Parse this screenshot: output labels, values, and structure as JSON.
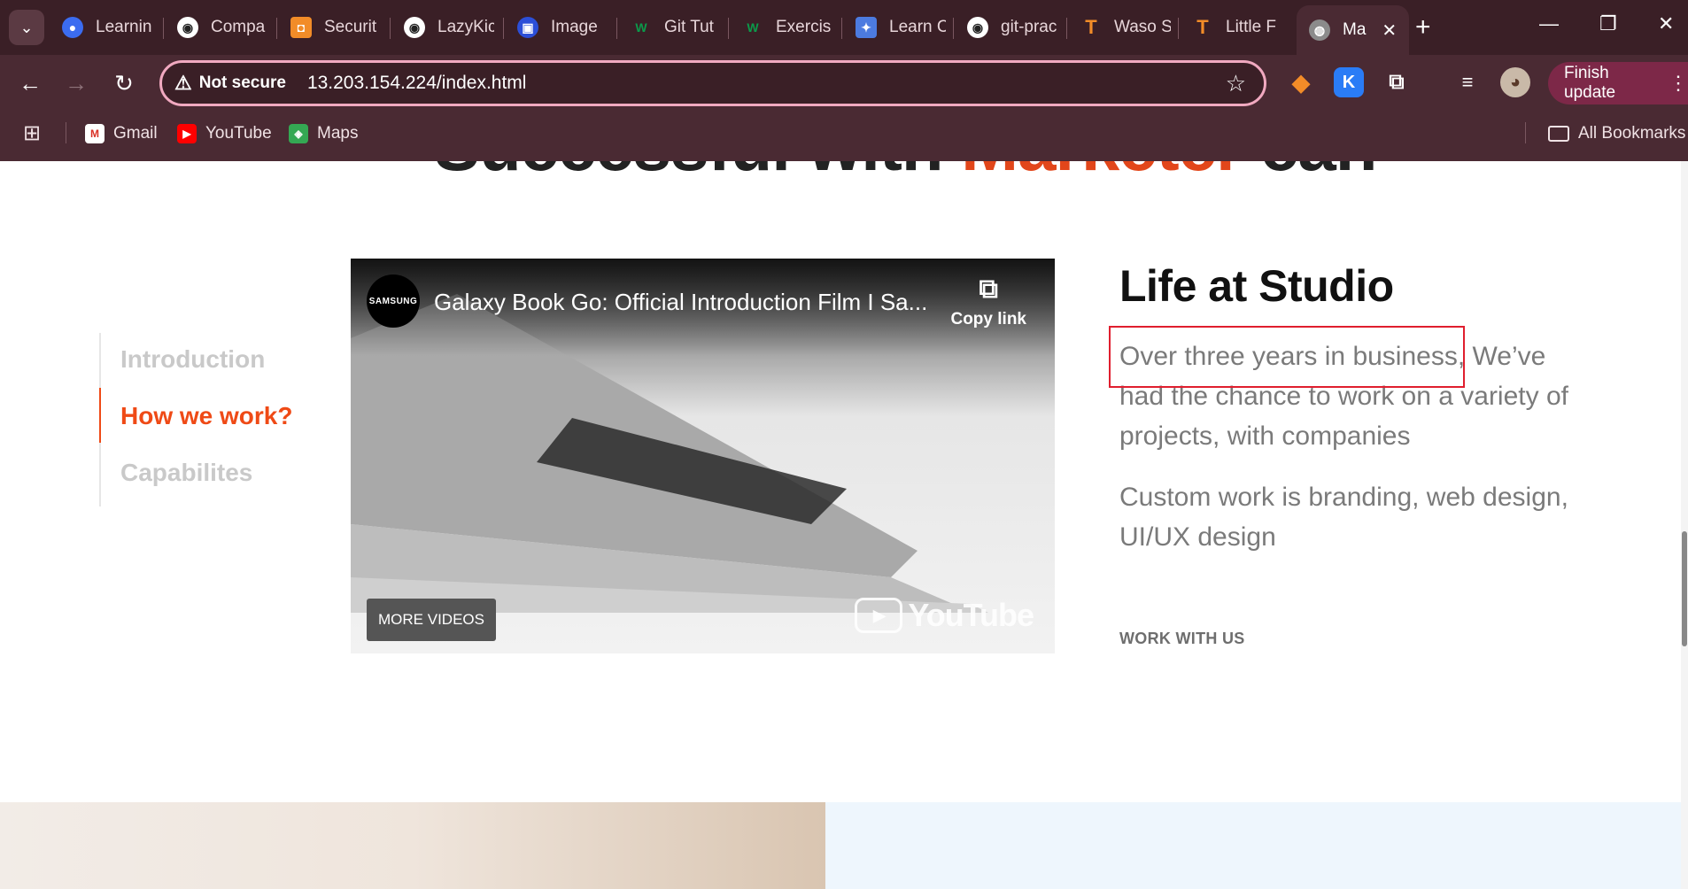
{
  "browser": {
    "tabs": [
      {
        "label": "Learnin",
        "icon": "learning-icon",
        "color": "#3b6cf0"
      },
      {
        "label": "Compa",
        "icon": "github-icon",
        "color": "#ffffff"
      },
      {
        "label": "Securit",
        "icon": "security-icon",
        "color": "#f28c28"
      },
      {
        "label": "LazyKic",
        "icon": "github-icon",
        "color": "#ffffff"
      },
      {
        "label": "Image",
        "icon": "image-icon",
        "color": "#2c4fd8"
      },
      {
        "label": "Git Tut",
        "icon": "w3schools-icon",
        "color": "#0b9a4a"
      },
      {
        "label": "Exercis",
        "icon": "w3schools-icon",
        "color": "#0b9a4a"
      },
      {
        "label": "Learn C",
        "icon": "learn-icon",
        "color": "#4c7be0"
      },
      {
        "label": "git-prac",
        "icon": "github-icon",
        "color": "#ffffff"
      },
      {
        "label": "Waso S",
        "icon": "t-icon",
        "color": "#f28c28"
      },
      {
        "label": "Little F",
        "icon": "t-icon",
        "color": "#f28c28"
      }
    ],
    "active_tab": {
      "label": "Ma",
      "icon": "globe-icon"
    },
    "address": {
      "security_label": "Not secure",
      "url": "13.203.154.224/index.html"
    },
    "finish_update_label": "Finish update",
    "bookmarks": [
      {
        "label": "Gmail",
        "icon": "gmail-icon"
      },
      {
        "label": "YouTube",
        "icon": "youtube-icon"
      },
      {
        "label": "Maps",
        "icon": "maps-icon"
      }
    ],
    "all_bookmarks_label": "All Bookmarks"
  },
  "page": {
    "heading_partial": {
      "before": "Successful with ",
      "highlight": "Marketer",
      "after": " can"
    },
    "side_nav": [
      "Introduction",
      "How we work?",
      "Capabilites"
    ],
    "side_nav_active": 1,
    "video": {
      "channel": "SAMSUNG",
      "title": "Galaxy Book Go: Official Introduction Film I Sa...",
      "copy_link": "Copy link",
      "more_videos": "MORE VIDEOS",
      "youtube": "YouTube"
    },
    "section": {
      "title": "Life at Studio",
      "paragraph1": "Over three years in business, We’ve had the chance to work on a variety of projects, with companies",
      "paragraph2": "Custom work is branding, web design, UI/UX design",
      "cta": "WORK WITH US"
    }
  },
  "colors": {
    "accent": "#ef4a16",
    "highlight_box": "#e01e2e"
  }
}
